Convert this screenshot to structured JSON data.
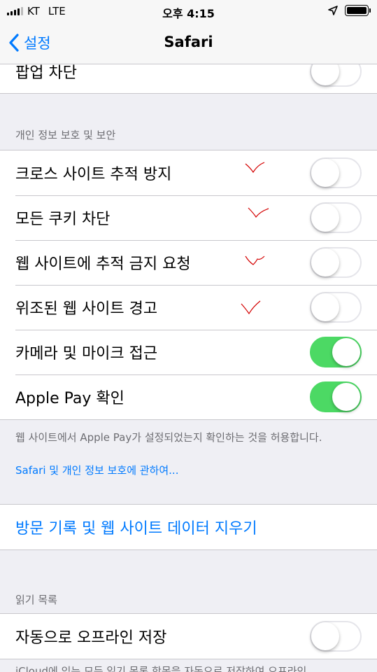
{
  "status_bar": {
    "carrier": "KT",
    "network": "LTE",
    "time": "오후 4:15"
  },
  "nav": {
    "back_label": "설정",
    "title": "Safari"
  },
  "top_partial_row": {
    "label": "팝업 차단",
    "toggle_on": false
  },
  "privacy_section": {
    "header": "개인 정보 보호 및 보안",
    "rows": [
      {
        "label": "크로스 사이트 추적 방지",
        "toggle_on": false
      },
      {
        "label": "모든 쿠키 차단",
        "toggle_on": false
      },
      {
        "label": "웹 사이트에 추적 금지 요청",
        "toggle_on": false
      },
      {
        "label": "위조된 웹 사이트 경고",
        "toggle_on": false
      },
      {
        "label": "카메라 및 마이크 접근",
        "toggle_on": true
      },
      {
        "label": "Apple Pay 확인",
        "toggle_on": true
      }
    ],
    "footer": "웹 사이트에서 Apple Pay가 설정되었는지 확인하는 것을 허용합니다.",
    "footer_link": "Safari 및 개인 정보 보호에 관하여..."
  },
  "clear_history": {
    "label": "방문 기록 및 웹 사이트 데이터 지우기"
  },
  "reading_list_section": {
    "header": "읽기 목록",
    "rows": [
      {
        "label": "자동으로 오프라인 저장",
        "toggle_on": false
      }
    ],
    "footer_partial": "iCloud에 있는 모든 읽기 목록 항목을 자동으로 저장하여 오프라인"
  },
  "colors": {
    "accent": "#007aff",
    "toggle_on": "#4cd964",
    "annotation": "#d40000"
  }
}
